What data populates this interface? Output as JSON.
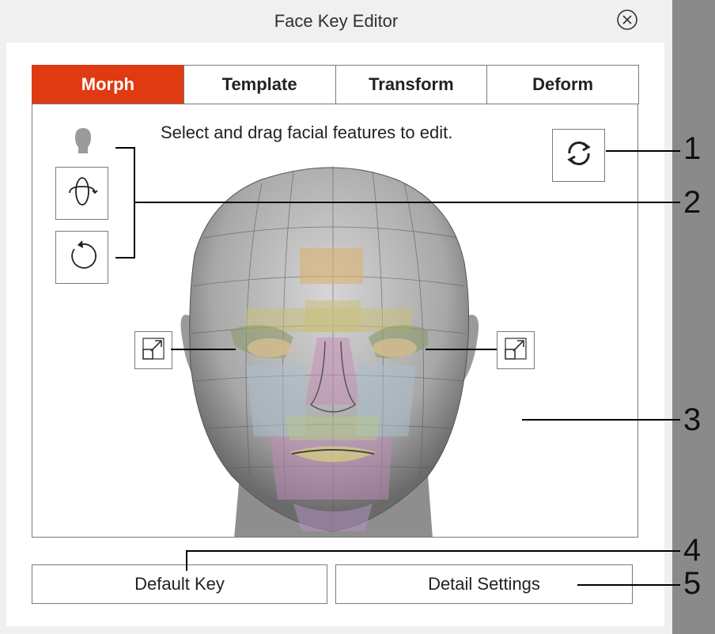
{
  "window": {
    "title": "Face Key Editor"
  },
  "tabs": [
    {
      "label": "Morph",
      "active": true
    },
    {
      "label": "Template",
      "active": false
    },
    {
      "label": "Transform",
      "active": false
    },
    {
      "label": "Deform",
      "active": false
    }
  ],
  "viewport": {
    "instruction": "Select and drag facial features to edit."
  },
  "buttons": {
    "default_key": "Default Key",
    "detail_settings": "Detail Settings"
  },
  "callouts": [
    "1",
    "2",
    "3",
    "4",
    "5"
  ],
  "colors": {
    "accent": "#e03a12",
    "border": "#7a7a7a"
  },
  "icons": [
    "close-icon",
    "head-silhouette-icon",
    "orbit-icon",
    "rotate-icon",
    "reset-sync-icon",
    "expand-icon"
  ]
}
